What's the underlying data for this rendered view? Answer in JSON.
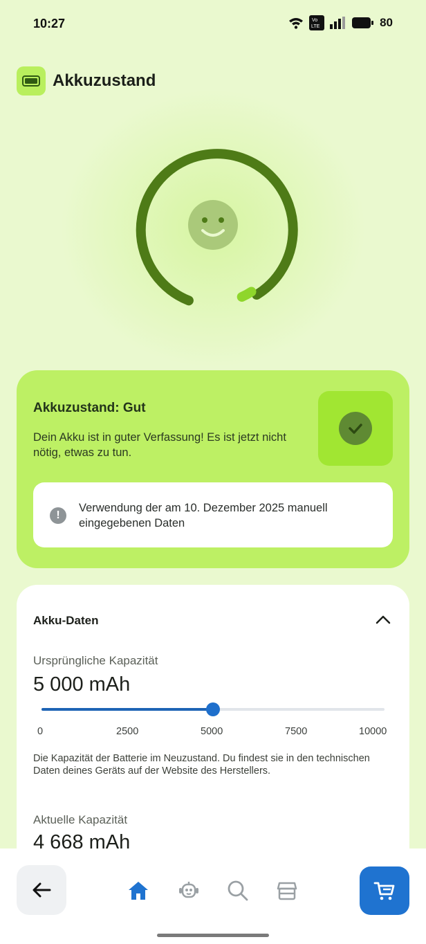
{
  "status_bar": {
    "time": "10:27",
    "battery": "80",
    "icons": [
      "wifi-icon",
      "volte-icon",
      "signal-icon",
      "battery-icon"
    ]
  },
  "header": {
    "title": "Akkuzustand",
    "icon": "battery-icon"
  },
  "gauge": {
    "icon": "smiley-icon",
    "level": 0.98,
    "colors": {
      "track": "#4e7b17",
      "accent": "#8fd62c",
      "face": "#aac97a"
    }
  },
  "status_card": {
    "title": "Akkuzustand: Gut",
    "text": "Dein Akku ist in guter Verfassung! Es ist jetzt nicht nötig, etwas zu tun.",
    "info_text": "Verwendung der am 10. Dezember 2025 manuell eingegebenen Daten",
    "info_icon_glyph": "!",
    "check_icon": "checkmark-icon",
    "colors": {
      "card": "#bdf064",
      "check_bg": "#a1e632",
      "check_circle": "#5f8a33"
    }
  },
  "data_card": {
    "title": "Akku-Daten",
    "original_label": "Ursprüngliche Kapazität",
    "original_value": "5 000 mAh",
    "slider": {
      "min": 0,
      "max": 10000,
      "value": 5000,
      "ticks": [
        "0",
        "2500",
        "5000",
        "7500",
        "10000"
      ]
    },
    "description": "Die Kapazität der Batterie im Neuzustand. Du findest sie in den technischen Daten deines Geräts auf der Website des Herstellers.",
    "current_label": "Aktuelle Kapazität",
    "current_value": "4 668 mAh"
  },
  "bottom_nav": {
    "items": [
      "back-arrow-icon",
      "home-icon",
      "robot-icon",
      "search-icon",
      "store-icon",
      "cart-icon"
    ],
    "active": "home-icon",
    "accent": "#1f73d0"
  }
}
